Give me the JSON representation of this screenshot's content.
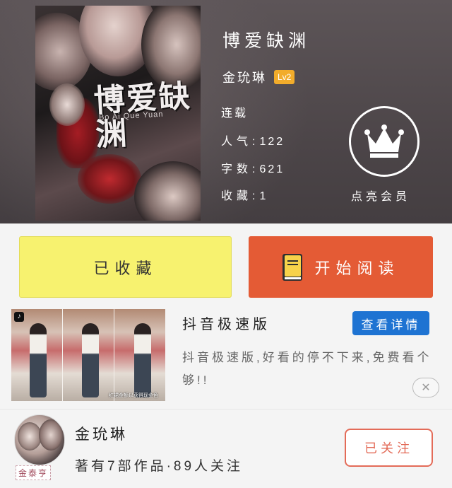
{
  "book": {
    "cover_title": "博爱缺渊",
    "cover_subtitle": "Bo Ai Que Yuan",
    "title": "博爱缺渊",
    "author": "金玧琳",
    "level": "Lv2",
    "status": "连载",
    "popularity_label": "人气:",
    "popularity": "122",
    "word_count_label": "字数:",
    "word_count": "621",
    "favorites_label": "收藏:",
    "favorites": "1"
  },
  "vip": {
    "label": "点亮会员",
    "icon": "crown-icon"
  },
  "actions": {
    "favorite_label": "已收藏",
    "read_label": "开始阅读",
    "read_icon": "book-icon"
  },
  "ad": {
    "title": "抖音极速版",
    "detail_button": "查看详情",
    "description": "抖音极速版,好看的停不下来,免费看个够!!",
    "image_caption": "红裙金额以获得现金色",
    "app_icon": "tiktok-icon",
    "close_icon": "close-icon"
  },
  "author_card": {
    "name": "金玧琳",
    "stats": "著有7部作品·89人关注",
    "follow_label": "已关注",
    "avatar_tag": "金泰亨"
  },
  "colors": {
    "fav_button": "#f7f26f",
    "read_button": "#e45b35",
    "detail_button": "#1e73d2",
    "level_badge": "#f2ac2b",
    "follow_border": "#e36b58"
  }
}
